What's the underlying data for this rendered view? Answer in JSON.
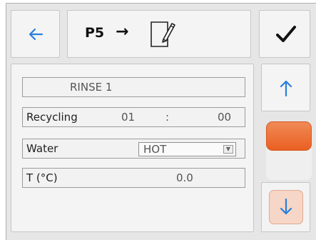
{
  "header": {
    "back_icon": "arrow-left-icon",
    "program": "P5",
    "arrow": "→",
    "edit_icon": "edit-document-icon",
    "confirm_icon": "checkmark-icon"
  },
  "panel": {
    "step_title": "RINSE 1",
    "recycling": {
      "label": "Recycling",
      "minutes": "01",
      "separator": ":",
      "seconds": "00"
    },
    "water": {
      "label": "Water",
      "selected": "HOT"
    },
    "temperature": {
      "label": "T (°C)",
      "value": "0.0"
    }
  },
  "scroll": {
    "up_icon": "arrow-up-icon",
    "down_icon": "arrow-down-icon",
    "thumb_fraction": 0.5
  },
  "colors": {
    "accent_blue": "#2a7fd9",
    "thumb_orange": "#ef6a2e",
    "down_button_tint": "#f6d6c6"
  }
}
